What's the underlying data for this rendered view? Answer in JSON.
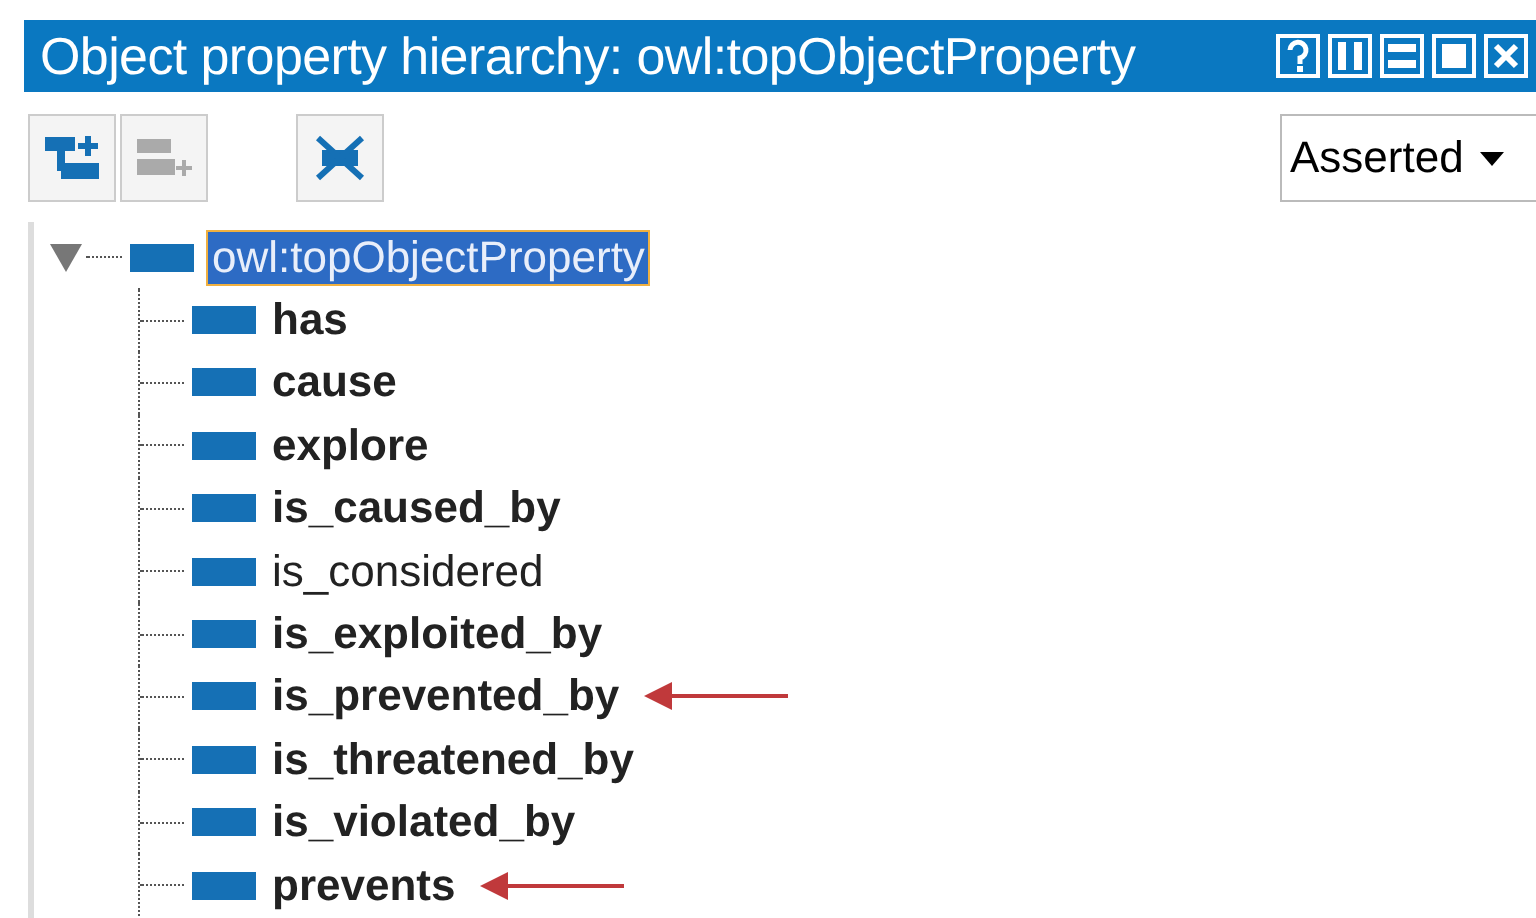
{
  "window": {
    "title": "Object property hierarchy: owl:topObjectProperty"
  },
  "toolbar": {
    "buttons": [
      {
        "kind": "add-sub",
        "disabled": false
      },
      {
        "kind": "add-sibling",
        "disabled": true
      },
      {
        "kind": "delete",
        "disabled": false
      }
    ],
    "mode": {
      "value": "Asserted"
    }
  },
  "tree": {
    "label": "owl:topObjectProperty",
    "expanded": true,
    "selected": true,
    "children": [
      {
        "label": "has",
        "bold": true,
        "marked": false
      },
      {
        "label": "cause",
        "bold": true,
        "marked": false
      },
      {
        "label": "explore",
        "bold": true,
        "marked": false
      },
      {
        "label": "is_caused_by",
        "bold": true,
        "marked": false
      },
      {
        "label": "is_considered",
        "bold": false,
        "marked": false
      },
      {
        "label": "is_exploited_by",
        "bold": true,
        "marked": false
      },
      {
        "label": "is_prevented_by",
        "bold": true,
        "marked": true
      },
      {
        "label": "is_threatened_by",
        "bold": true,
        "marked": false
      },
      {
        "label": "is_violated_by",
        "bold": true,
        "marked": false
      },
      {
        "label": "prevents",
        "bold": true,
        "marked": true
      }
    ]
  }
}
